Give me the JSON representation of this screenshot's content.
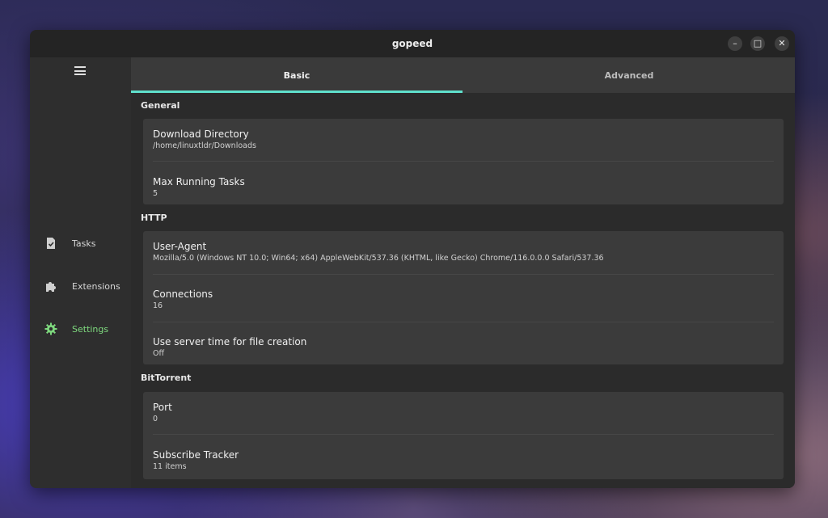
{
  "window": {
    "title": "gopeed",
    "controls": {
      "minimize": "–",
      "maximize": "□",
      "close": "✕"
    }
  },
  "sidebar": {
    "menu_icon": "hamburger-menu-icon",
    "items": [
      {
        "label": "Tasks",
        "icon": "task-list-icon",
        "active": false
      },
      {
        "label": "Extensions",
        "icon": "puzzle-piece-icon",
        "active": false
      },
      {
        "label": "Settings",
        "icon": "gear-icon",
        "active": true
      }
    ]
  },
  "tabs": [
    {
      "label": "Basic",
      "active": true
    },
    {
      "label": "Advanced",
      "active": false
    }
  ],
  "sections": {
    "general": {
      "title": "General",
      "download_directory": {
        "label": "Download Directory",
        "value": "/home/linuxtldr/Downloads"
      },
      "max_running_tasks": {
        "label": "Max Running Tasks",
        "value": "5"
      }
    },
    "http": {
      "title": "HTTP",
      "user_agent": {
        "label": "User-Agent",
        "value": "Mozilla/5.0 (Windows NT 10.0; Win64; x64) AppleWebKit/537.36 (KHTML, like Gecko) Chrome/116.0.0.0 Safari/537.36"
      },
      "connections": {
        "label": "Connections",
        "value": "16"
      },
      "server_time": {
        "label": "Use server time for file creation",
        "value": "Off"
      }
    },
    "bittorrent": {
      "title": "BitTorrent",
      "port": {
        "label": "Port",
        "value": "0"
      },
      "subscribe_tracker": {
        "label": "Subscribe Tracker",
        "value": "11 items"
      }
    }
  },
  "colors": {
    "accent_tab_indicator": "#5fe0cc",
    "active_nav": "#7ed97e",
    "window_bg": "#2e2e2e",
    "card_bg": "#3b3b3b"
  }
}
